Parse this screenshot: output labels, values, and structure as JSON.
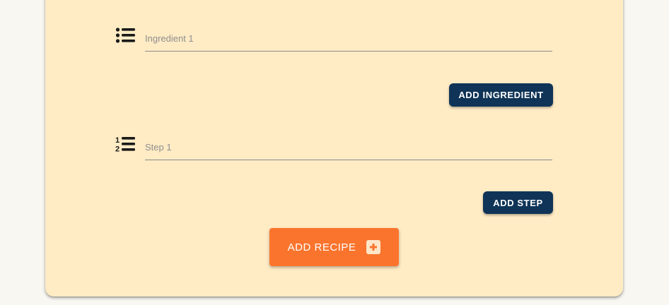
{
  "form": {
    "ingredient_placeholder": "Ingredient 1",
    "ingredient_value": "",
    "step_placeholder": "Step 1",
    "step_value": "",
    "add_ingredient_label": "ADD INGREDIENT",
    "add_step_label": "ADD STEP",
    "add_recipe_label": "ADD RECIPE"
  },
  "icons": {
    "ingredient": "list-bullet-icon",
    "step": "list-numbered-icon",
    "add_recipe": "plus-square-icon"
  },
  "colors": {
    "card_background": "#ffebc4",
    "page_background": "#f8f7f2",
    "navy_button": "#0f3457",
    "orange_button": "#fa742d"
  }
}
